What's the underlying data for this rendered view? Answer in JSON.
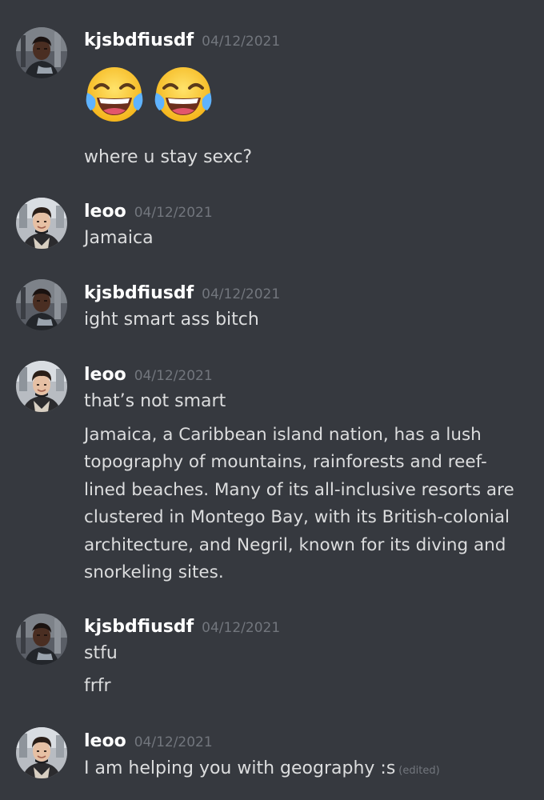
{
  "messages": [
    {
      "username": "kjsbdfiusdf",
      "timestamp": "04/12/2021",
      "emojis": [
        "face-with-tears-of-joy",
        "face-with-tears-of-joy"
      ],
      "lines": [
        "where u stay sexc?"
      ]
    },
    {
      "username": "leoo",
      "timestamp": "04/12/2021",
      "lines": [
        "Jamaica"
      ]
    },
    {
      "username": "kjsbdfiusdf",
      "timestamp": "04/12/2021",
      "lines": [
        "ight smart ass bitch"
      ]
    },
    {
      "username": "leoo",
      "timestamp": "04/12/2021",
      "lines": [
        "that’s not smart",
        "Jamaica, a Caribbean island nation, has a lush topography of mountains, rainforests and reef-lined beaches. Many of its all-inclusive resorts are clustered in Montego Bay, with its British-colonial architecture, and Negril, known for its diving and snorkeling sites."
      ]
    },
    {
      "username": "kjsbdfiusdf",
      "timestamp": "04/12/2021",
      "lines": [
        "stfu",
        "frfr"
      ]
    },
    {
      "username": "leoo",
      "timestamp": "04/12/2021",
      "lines": [
        "I am helping you with geography :s"
      ],
      "edited_label": "(edited)"
    }
  ],
  "colors": {
    "background": "#36393f",
    "username": "#ffffff",
    "timestamp": "#72767d",
    "message_text": "#dcddde"
  }
}
